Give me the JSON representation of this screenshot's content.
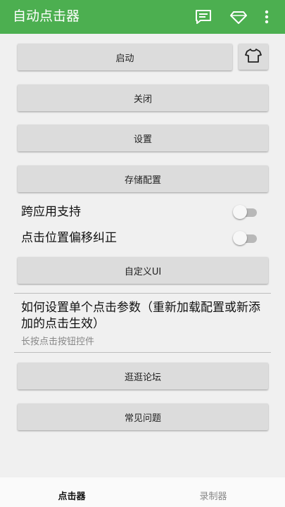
{
  "app": {
    "title": "自动点击器",
    "colors": {
      "appbar": "#4caf50",
      "background": "#f0f0f0",
      "button": "#dcdcdc"
    },
    "icons": [
      "message-icon",
      "diamond-icon",
      "more-vert-icon"
    ]
  },
  "controls": {
    "start_label": "启动",
    "shirt_icon": "shirt-icon",
    "close_label": "关闭",
    "settings_label": "设置",
    "save_config_label": "存储配置",
    "cross_app_label": "跨应用支持",
    "cross_app_enabled": false,
    "offset_fix_label": "点击位置偏移纠正",
    "offset_fix_enabled": false,
    "custom_ui_label": "自定义UI"
  },
  "info": {
    "title": "如何设置单个点击参数（重新加载配置或新添加的点击生效）",
    "subtitle": "长按点击按钮控件"
  },
  "links": {
    "forum_label": "逛逛论坛",
    "faq_label": "常见问题"
  },
  "bottom_nav": {
    "tabs": [
      {
        "label": "点击器",
        "active": true
      },
      {
        "label": "录制器",
        "active": false
      }
    ]
  }
}
